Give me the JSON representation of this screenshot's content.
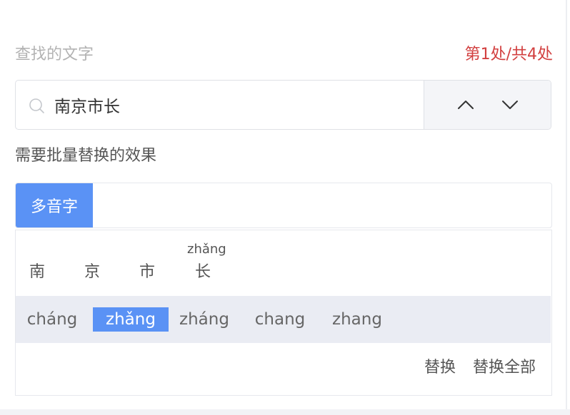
{
  "find": {
    "label": "查找的文字",
    "counter": "第1处/共4处",
    "search_value": "南京市长"
  },
  "effect": {
    "label": "需要批量替换的效果"
  },
  "tabs": [
    {
      "label": "多音字",
      "active": true
    }
  ],
  "characters": [
    {
      "char": "南",
      "pinyin": ""
    },
    {
      "char": "京",
      "pinyin": ""
    },
    {
      "char": "市",
      "pinyin": ""
    },
    {
      "char": "长",
      "pinyin": "zhǎng"
    }
  ],
  "options": [
    {
      "label": "cháng",
      "selected": false
    },
    {
      "label": "zhǎng",
      "selected": true
    },
    {
      "label": "zháng",
      "selected": false
    },
    {
      "label": "chang",
      "selected": false
    },
    {
      "label": "zhang",
      "selected": false
    }
  ],
  "actions": {
    "replace": "替换",
    "replace_all": "替换全部"
  },
  "colors": {
    "accent": "#5a92f5",
    "counter": "#d23f3f"
  }
}
